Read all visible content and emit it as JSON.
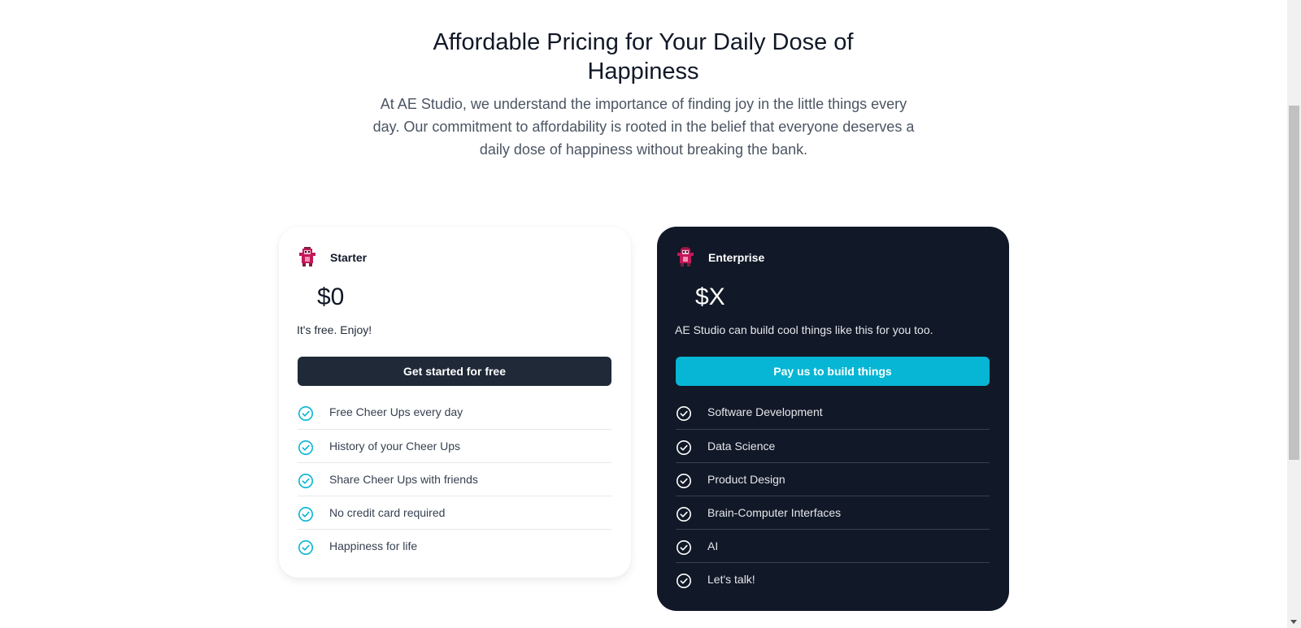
{
  "hero": {
    "title": "Affordable Pricing for Your Daily Dose of Happiness",
    "description": "At AE Studio, we understand the importance of finding joy in the little things every day. Our commitment to affordability is rooted in the belief that everyone deserves a daily dose of happiness without breaking the bank."
  },
  "plans": [
    {
      "name": "Starter",
      "price": "$0",
      "tagline": "It's free. Enjoy!",
      "cta_label": "Get started for free",
      "features": [
        "Free Cheer Ups every day",
        "History of your Cheer Ups",
        "Share Cheer Ups with friends",
        "No credit card required",
        "Happiness for life"
      ]
    },
    {
      "name": "Enterprise",
      "price": "$X",
      "tagline": "AE Studio can build cool things like this for you too.",
      "cta_label": "Pay us to build things",
      "features": [
        "Software Development",
        "Data Science",
        "Product Design",
        "Brain-Computer Interfaces",
        "AI",
        "Let's talk!"
      ]
    }
  ],
  "colors": {
    "dark_card": "#111827",
    "starter_button": "#1f2937",
    "accent_cyan": "#06b6d4",
    "icon_pink": "#c2185b"
  },
  "icons": {
    "plan_icon": "pixel-monkey-icon",
    "feature_icon": "check-circle-icon"
  }
}
